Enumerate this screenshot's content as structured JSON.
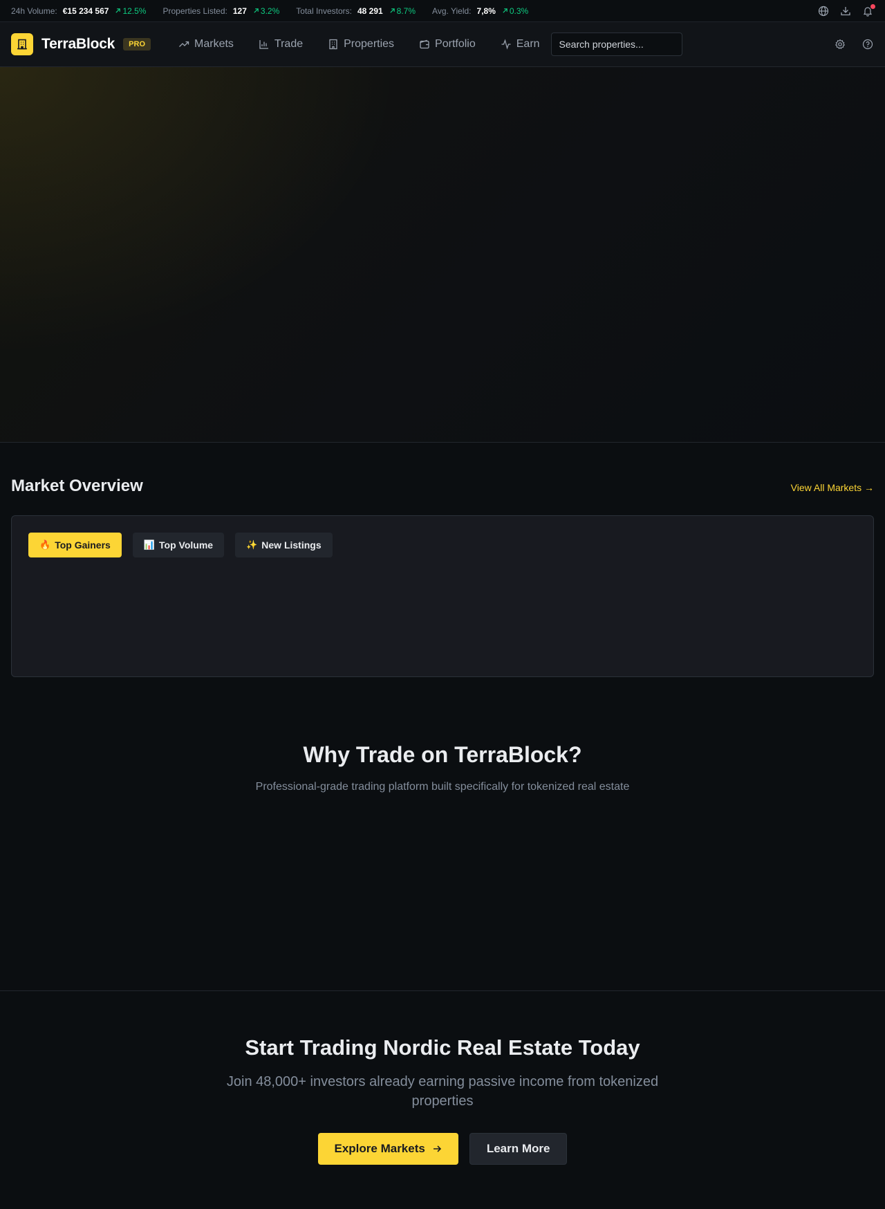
{
  "colors": {
    "accent": "#fcd535",
    "positive": "#0ecb81",
    "background": "#0b0e11",
    "card": "#181a20",
    "notification_dot": "#f6465d"
  },
  "ticker": {
    "stats": [
      {
        "label": "24h Volume:",
        "value": "€15 234 567",
        "change": "12.5%"
      },
      {
        "label": "Properties Listed:",
        "value": "127",
        "change": "3.2%"
      },
      {
        "label": "Total Investors:",
        "value": "48 291",
        "change": "8.7%"
      },
      {
        "label": "Avg. Yield:",
        "value": "7,8%",
        "change": "0.3%"
      }
    ],
    "icons": [
      "globe-icon",
      "download-icon",
      "bell-icon"
    ]
  },
  "header": {
    "brand": "TerraBlock",
    "badge": "PRO",
    "nav": [
      {
        "label": "Markets",
        "icon": "trending-up-icon"
      },
      {
        "label": "Trade",
        "icon": "bar-chart-icon"
      },
      {
        "label": "Properties",
        "icon": "building-icon"
      },
      {
        "label": "Portfolio",
        "icon": "wallet-icon"
      },
      {
        "label": "Earn",
        "icon": "activity-icon"
      }
    ],
    "search_placeholder": "Search properties...",
    "right_icons": [
      "gear-icon",
      "help-icon"
    ]
  },
  "market_overview": {
    "title": "Market Overview",
    "view_all": "View All Markets →",
    "tabs": [
      {
        "icon": "🔥",
        "label": "Top Gainers",
        "active": true
      },
      {
        "icon": "📊",
        "label": "Top Volume",
        "active": false
      },
      {
        "icon": "✨",
        "label": "New Listings",
        "active": false
      }
    ]
  },
  "why": {
    "title": "Why Trade on TerraBlock?",
    "subtitle": "Professional-grade trading platform built specifically for tokenized real estate"
  },
  "cta": {
    "title": "Start Trading Nordic Real Estate Today",
    "subtitle": "Join 48,000+ investors already earning passive income from tokenized properties",
    "primary": "Explore Markets",
    "secondary": "Learn More"
  }
}
